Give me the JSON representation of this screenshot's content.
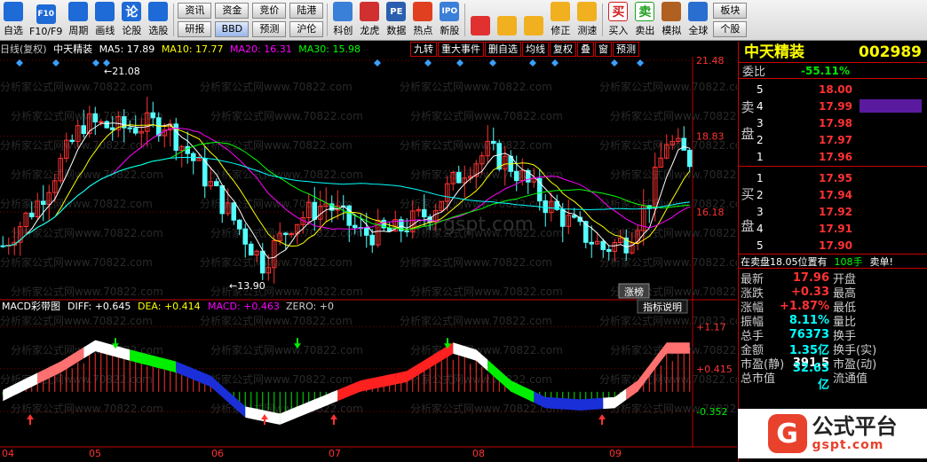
{
  "toolbar": {
    "buttons": [
      {
        "label": "自选",
        "icon": "star-list-icon",
        "color": "#1e6ad6"
      },
      {
        "label": "F10/F9",
        "icon": "f10-icon",
        "color": "#1e6ad6"
      },
      {
        "label": "周期",
        "icon": "clock-cycle-icon",
        "color": "#1e6ad6"
      },
      {
        "label": "画线",
        "icon": "draw-line-icon",
        "color": "#1e6ad6"
      },
      {
        "label": "论股",
        "icon": "discuss-icon",
        "color": "#1e6ad6"
      },
      {
        "label": "选股",
        "icon": "select-stock-icon",
        "color": "#1e6ad6"
      }
    ],
    "pairs": [
      {
        "top": "资讯",
        "bottom": "研报"
      },
      {
        "top": "资金",
        "bottom": "BBD"
      },
      {
        "top": "竞价",
        "bottom": "预测"
      },
      {
        "top": "陆港",
        "bottom": "沪伦"
      }
    ],
    "buttons2": [
      {
        "label": "科创",
        "icon": "kechuang-icon",
        "color": "#3a7fd8"
      },
      {
        "label": "龙虎",
        "icon": "dragon-tiger-icon",
        "color": "#d03030"
      },
      {
        "label": "数据",
        "icon": "data-pe-icon",
        "color": "#2a5fb0"
      },
      {
        "label": "热点",
        "icon": "hot-icon",
        "color": "#e04020"
      },
      {
        "label": "新股",
        "icon": "ipo-icon",
        "color": "#3a7fd8"
      }
    ],
    "buttons3": [
      {
        "label": "",
        "icon": "layout-grid-icon",
        "color": "#e03030"
      },
      {
        "label": "",
        "icon": "back-arrow-icon",
        "color": "#f0b020"
      },
      {
        "label": "",
        "icon": "up-down-icon",
        "color": "#f0b020"
      },
      {
        "label": "修正",
        "icon": "revise-icon",
        "color": "#f0b020"
      },
      {
        "label": "测速",
        "icon": "stopwatch-icon",
        "color": "#f0b020"
      }
    ],
    "buttons4": [
      {
        "label": "买入",
        "glyph": "买",
        "icon": "buy-icon",
        "color": "#d02020"
      },
      {
        "label": "卖出",
        "glyph": "卖",
        "icon": "sell-icon",
        "color": "#20a020"
      },
      {
        "label": "模拟",
        "icon": "gavel-icon",
        "color": "#b06020"
      },
      {
        "label": "全球",
        "icon": "globe-icon",
        "color": "#2a6fd0"
      }
    ],
    "right_pairs": [
      {
        "top": "板块",
        "bottom": "个股"
      }
    ],
    "glyphs": {
      "f10": "F10",
      "lun": "论",
      "pe": "PE",
      "ipo": "IPO"
    }
  },
  "infobar": {
    "period": "日线(复权)",
    "name": "中天精装",
    "ma5": "MA5: 17.89",
    "ma10": "MA10: 17.77",
    "ma20": "MA20: 16.31",
    "ma30": "MA30: 15.98",
    "tabs": [
      "九转",
      "重大事件",
      "删自选",
      "均线",
      "复权",
      "叠",
      "窗",
      "预测"
    ]
  },
  "colors": {
    "ma5": "#ffffff",
    "ma10": "#ffff00",
    "ma20": "#ff00ff",
    "ma30": "#00ff00",
    "ma60": "#00ffff",
    "up": "#ff3232",
    "down": "#54ffff",
    "grid": "#800000",
    "axis": "#c00000"
  },
  "price_chart": {
    "y_labels": [
      "21.48",
      "18.83",
      "16.18"
    ],
    "high_mark": "21.08",
    "low_mark": "13.90",
    "badge": "涨榜",
    "watermark": "分析家公式网www.70822.com",
    "site_watermark": "www.gspt.com",
    "ymin": 13.3,
    "ymax": 21.48
  },
  "macd": {
    "title": "MACD彩带图",
    "diff": "DIFF: +0.645",
    "dea": "DEA: +0.414",
    "macd": "MACD: +0.463",
    "zero": "ZERO: +0",
    "help": "指标说明",
    "y_labels": [
      "+1.17",
      "+0.415",
      "-0.352"
    ]
  },
  "x_axis": [
    "04",
    "05",
    "06",
    "07",
    "08",
    "09"
  ],
  "panel": {
    "name": "中天精装",
    "code": "002989",
    "weibi_label": "委比",
    "weibi": "-55.11%",
    "sell_label": [
      "卖",
      "盘"
    ],
    "buy_label": [
      "买",
      "盘"
    ],
    "asks": [
      {
        "lv": "5",
        "price": "18.00"
      },
      {
        "lv": "4",
        "price": "17.99"
      },
      {
        "lv": "3",
        "price": "17.98"
      },
      {
        "lv": "2",
        "price": "17.97"
      },
      {
        "lv": "1",
        "price": "17.96"
      }
    ],
    "bids": [
      {
        "lv": "1",
        "price": "17.95"
      },
      {
        "lv": "2",
        "price": "17.94"
      },
      {
        "lv": "3",
        "price": "17.92"
      },
      {
        "lv": "4",
        "price": "17.91"
      },
      {
        "lv": "5",
        "price": "17.90"
      }
    ],
    "note": "在卖盘18.05位置有",
    "note_vol": "108手",
    "note_end": "卖单!",
    "quotes": [
      {
        "k": "最新",
        "v": "17.96",
        "c": "red",
        "k2": "开盘"
      },
      {
        "k": "涨跌",
        "v": "+0.33",
        "c": "red",
        "k2": "最高"
      },
      {
        "k": "涨幅",
        "v": "+1.87%",
        "c": "red",
        "k2": "最低"
      },
      {
        "k": "振幅",
        "v": "8.11%",
        "c": "cyan",
        "k2": "量比"
      },
      {
        "k": "总手",
        "v": "76373",
        "c": "cyan",
        "k2": "换手"
      },
      {
        "k": "金额",
        "v": "1.35亿",
        "c": "cyan",
        "k2": "换手(实)"
      },
      {
        "k": "市盈(静)",
        "v": "391.5",
        "c": "white",
        "k2": "市盈(动)"
      },
      {
        "k": "总市值",
        "v": "32.63亿",
        "c": "cyan",
        "k2": "流通值"
      }
    ]
  },
  "logo": {
    "text": "公式平台",
    "sub": "gspt.com",
    "glyph": "G"
  }
}
